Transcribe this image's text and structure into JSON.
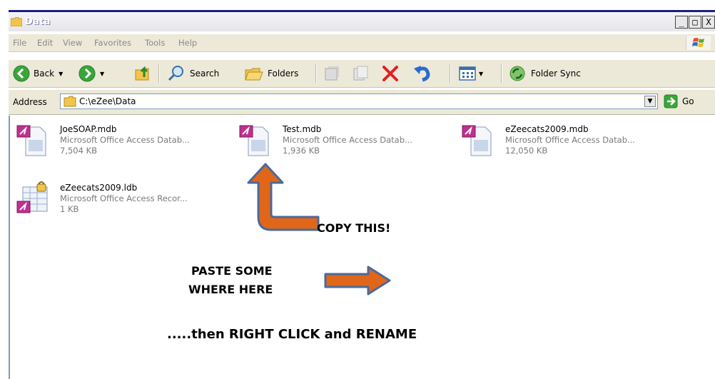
{
  "window": {
    "title": "Data"
  },
  "window_buttons": [
    "_",
    "□",
    "X"
  ],
  "menu": [
    "File",
    "Edit",
    "View",
    "Favorites",
    "Tools",
    "Help"
  ],
  "toolbar": {
    "back_label": "Back",
    "search_label": "Search",
    "folders_label": "Folders",
    "folder_sync_label": "Folder Sync"
  },
  "address": {
    "label": "Address",
    "value": "C:\\eZee\\Data",
    "go_label": "Go"
  },
  "files": [
    {
      "name": "JoeSOAP.mdb",
      "type": "Microsoft Office Access Datab...",
      "size": "7,504 KB",
      "icon": "access-database-icon"
    },
    {
      "name": "Test.mdb",
      "type": "Microsoft Office Access Datab...",
      "size": "1,936 KB",
      "icon": "access-database-icon"
    },
    {
      "name": "eZeecats2009.mdb",
      "type": "Microsoft Office Access Datab...",
      "size": "12,050 KB",
      "icon": "access-database-icon"
    },
    {
      "name": "eZeecats2009.ldb",
      "type": "Microsoft Office Access Recor...",
      "size": "1 KB",
      "icon": "access-lock-record-icon"
    }
  ],
  "annotations": {
    "copy_this": "COPY THIS!",
    "paste_line1": "PASTE SOME",
    "paste_line2": "WHERE HERE",
    "then_rename": ".....then RIGHT CLICK and RENAME"
  },
  "colors": {
    "arrow_orange": "#e0661a",
    "arrow_outline": "#4a6a9a",
    "title_blue": "#1c1f88",
    "xp_chrome": "#ece9d8"
  }
}
